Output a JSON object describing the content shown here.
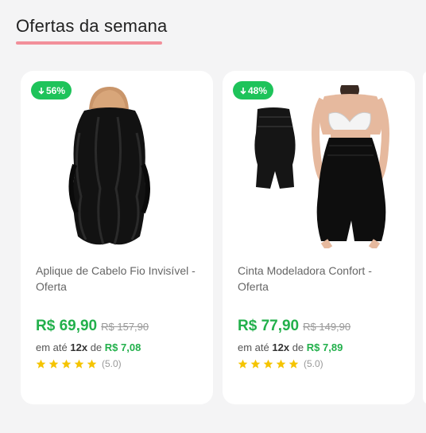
{
  "section": {
    "title": "Ofertas da semana"
  },
  "colors": {
    "accent_underline": "#f28f9a",
    "discount_badge": "#1ec35a",
    "price": "#22b04b",
    "star": "#f5c400"
  },
  "products": [
    {
      "discount": "56%",
      "image_icon": "hair-extension-image",
      "name": "Aplique de Cabelo Fio Invisível - Oferta",
      "price": "R$ 69,90",
      "old_price": "R$ 157,90",
      "installment_prefix": "em até",
      "installment_count": "12x",
      "installment_mid": "de",
      "installment_value": "R$ 7,08",
      "rating": 5,
      "rating_label": "(5.0)"
    },
    {
      "discount": "48%",
      "image_icon": "shapewear-image",
      "name": "Cinta Modeladora Confort - Oferta",
      "price": "R$ 77,90",
      "old_price": "R$ 149,90",
      "installment_prefix": "em até",
      "installment_count": "12x",
      "installment_mid": "de",
      "installment_value": "R$ 7,89",
      "rating": 5,
      "rating_label": "(5.0)"
    }
  ]
}
